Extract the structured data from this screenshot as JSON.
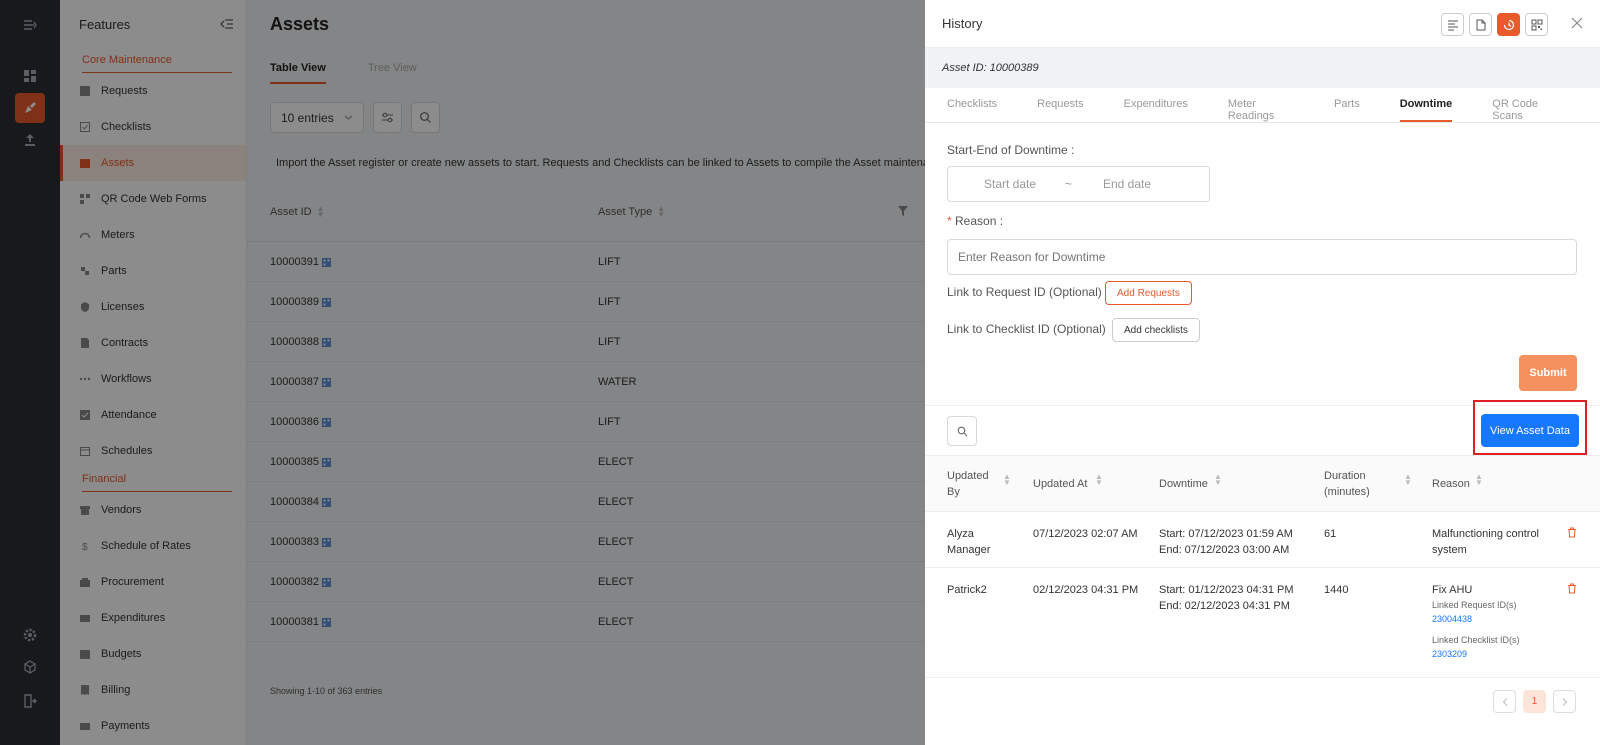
{
  "sidebar": {
    "title": "Features",
    "sections": [
      {
        "title": "Core Maintenance",
        "items": [
          {
            "label": "Requests",
            "icon": "request-icon"
          },
          {
            "label": "Checklists",
            "icon": "checklist-icon"
          },
          {
            "label": "Assets",
            "icon": "asset-icon",
            "active": true
          },
          {
            "label": "QR Code Web Forms",
            "icon": "qr-icon"
          },
          {
            "label": "Meters",
            "icon": "meter-icon"
          },
          {
            "label": "Parts",
            "icon": "parts-icon"
          },
          {
            "label": "Licenses",
            "icon": "license-icon"
          },
          {
            "label": "Contracts",
            "icon": "contract-icon"
          },
          {
            "label": "Workflows",
            "icon": "workflow-icon"
          },
          {
            "label": "Attendance",
            "icon": "attendance-icon"
          },
          {
            "label": "Schedules",
            "icon": "calendar-icon"
          }
        ]
      },
      {
        "title": "Financial",
        "items": [
          {
            "label": "Vendors",
            "icon": "vendor-icon"
          },
          {
            "label": "Schedule of Rates",
            "icon": "dollar-icon"
          },
          {
            "label": "Procurement",
            "icon": "procurement-icon"
          },
          {
            "label": "Expenditures",
            "icon": "expenditure-icon"
          },
          {
            "label": "Budgets",
            "icon": "budget-icon"
          },
          {
            "label": "Billing",
            "icon": "billing-icon"
          },
          {
            "label": "Payments",
            "icon": "payment-icon"
          }
        ]
      }
    ]
  },
  "main": {
    "title": "Assets",
    "tabs": [
      "Table View",
      "Tree View"
    ],
    "active_tab": "Table View",
    "entries": "10 entries",
    "info": "Import the Asset register or create new assets to start. Requests and Checklists can be linked to Assets to compile the Asset maintenance l",
    "columns": [
      "Asset ID",
      "Asset Type"
    ],
    "rows": [
      {
        "id": "10000391",
        "type": "LIFT"
      },
      {
        "id": "10000389",
        "type": "LIFT"
      },
      {
        "id": "10000388",
        "type": "LIFT"
      },
      {
        "id": "10000387",
        "type": "WATER"
      },
      {
        "id": "10000386",
        "type": "LIFT"
      },
      {
        "id": "10000385",
        "type": "ELECT"
      },
      {
        "id": "10000384",
        "type": "ELECT"
      },
      {
        "id": "10000383",
        "type": "ELECT"
      },
      {
        "id": "10000382",
        "type": "ELECT"
      },
      {
        "id": "10000381",
        "type": "ELECT"
      }
    ],
    "showing": "Showing 1-10 of 363 entries"
  },
  "drawer": {
    "title": "History",
    "asset_id": "Asset ID: 10000389",
    "tabs": [
      "Checklists",
      "Requests",
      "Expenditures",
      "Meter Readings",
      "Parts",
      "Downtime",
      "QR Code Scans"
    ],
    "active_tab": "Downtime",
    "form": {
      "range_label": "Start-End of Downtime",
      "start_placeholder": "Start date",
      "range_sep": "~",
      "end_placeholder": "End date",
      "reason_label": "Reason",
      "reason_required": "*",
      "reason_placeholder": "Enter Reason for Downtime",
      "link_request_label": "Link to Request ID (Optional)",
      "add_requests": "Add Requests",
      "link_checklist_label": "Link to Checklist ID (Optional)",
      "add_checklists": "Add checklists",
      "submit": "Submit"
    },
    "view_asset_data": "View Asset Data",
    "table": {
      "headers": {
        "updated_by_1": "Updated",
        "updated_by_2": "By",
        "updated_at": "Updated At",
        "downtime": "Downtime",
        "duration_1": "Duration",
        "duration_2": "(minutes)",
        "reason": "Reason"
      },
      "rows": [
        {
          "updated_by_1": "Alyza",
          "updated_by_2": "Manager",
          "updated_at": "07/12/2023 02:07 AM",
          "start": "Start: 07/12/2023 01:59 AM",
          "end": "End: 07/12/2023 03:00 AM",
          "duration": "61",
          "reason_1": "Malfunctioning control",
          "reason_2": "system"
        },
        {
          "updated_by_1": "Patrick2",
          "updated_at": "02/12/2023 04:31 PM",
          "start": "Start: 01/12/2023 04:31 PM",
          "end": "End: 02/12/2023 04:31 PM",
          "duration": "1440",
          "reason_1": "Fix AHU",
          "linked_request_label": "Linked Request ID(s)",
          "linked_request": "23004438",
          "linked_checklist_label": "Linked Checklist ID(s)",
          "linked_checklist": "2303209"
        }
      ]
    },
    "pagination": {
      "current": "1"
    }
  },
  "colors": {
    "accent": "#e8592b",
    "primary": "#1677ff",
    "highlight": "#e02020",
    "rail": "#2b2f35"
  }
}
